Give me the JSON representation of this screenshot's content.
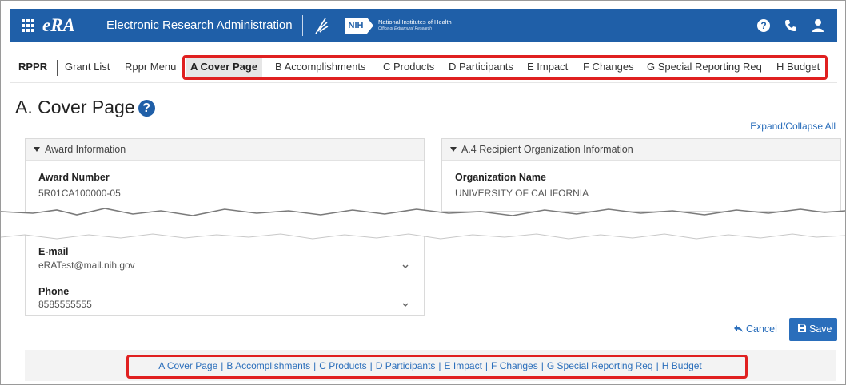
{
  "header": {
    "logo_text": "eRA",
    "app_title": "Electronic Research Administration",
    "nih_badge": "NIH",
    "nih_name": "National Institutes of Health",
    "nih_subtitle": "Office of Extramural Research",
    "icons": [
      "waffle-menu-icon",
      "hhs-eagle-icon",
      "help-icon",
      "phone-icon",
      "user-icon"
    ],
    "brand_color": "#1f5fa8"
  },
  "menu": {
    "app_name": "RPPR",
    "links": [
      "Grant List",
      "Rppr Menu"
    ],
    "sections": [
      "A Cover Page",
      "B Accomplishments",
      "C Products",
      "D Participants",
      "E Impact",
      "F Changes",
      "G Special Reporting Req",
      "H Budget"
    ],
    "active": "A Cover Page"
  },
  "page": {
    "title": "A. Cover Page",
    "expand_collapse": "Expand/Collapse All"
  },
  "award_panel": {
    "header": "Award Information",
    "award_number_label": "Award Number",
    "award_number": "5R01CA100000-05",
    "email_label": "E-mail",
    "email": "eRATest@mail.nih.gov",
    "phone_label": "Phone",
    "phone": "8585555555"
  },
  "org_panel": {
    "header": "A.4 Recipient Organization Information",
    "org_name_label": "Organization Name",
    "org_name": "UNIVERSITY OF CALIFORNIA"
  },
  "actions": {
    "cancel": "Cancel",
    "save": "Save"
  },
  "bottom_nav": {
    "links": [
      "A Cover Page",
      "B Accomplishments",
      "C Products",
      "D Participants",
      "E Impact",
      "F Changes",
      "G Special Reporting Req",
      "H Budget"
    ],
    "separator": "|"
  },
  "highlight_color": "#e02020"
}
